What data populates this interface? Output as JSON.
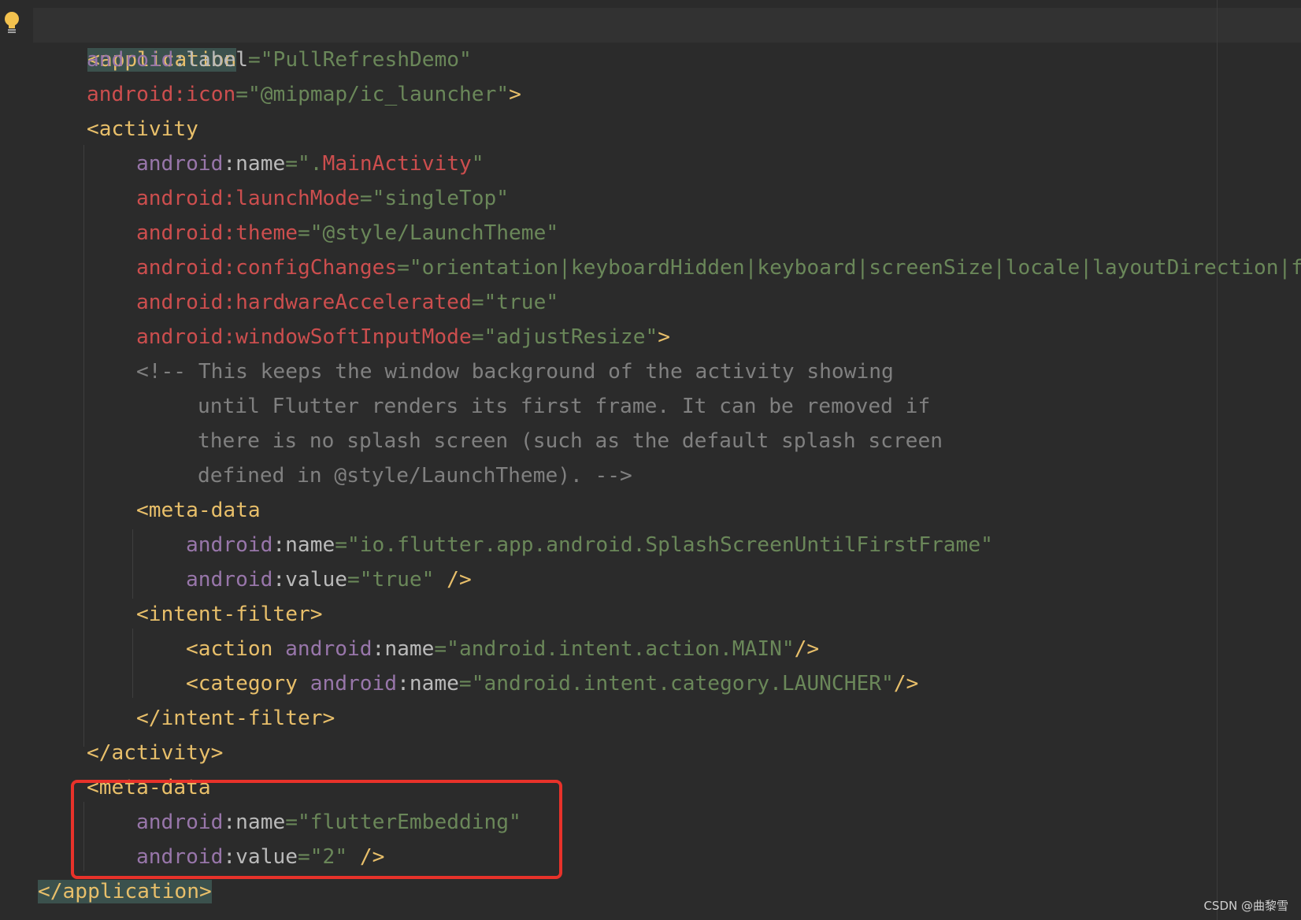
{
  "lines": [
    {
      "tag_open": "<application"
    },
    {
      "ns": "android",
      "attr": "label",
      "value": "PullRefreshDemo"
    },
    {
      "ns": "android",
      "attr": "icon",
      "value": "@mipmap/ic_launcher",
      "close": ">"
    },
    {
      "tag_open": "<activity"
    },
    {
      "ns": "android",
      "attr": "name",
      "value_prefix": ".",
      "value": "MainActivity"
    },
    {
      "ns": "android",
      "attr": "launchMode",
      "value": "singleTop"
    },
    {
      "ns": "android",
      "attr": "theme",
      "value": "@style/LaunchTheme"
    },
    {
      "ns": "android",
      "attr": "configChanges",
      "value": "orientation|keyboardHidden|keyboard|screenSize|locale|layoutDirection|fo"
    },
    {
      "ns": "android",
      "attr": "hardwareAccelerated",
      "value": "true"
    },
    {
      "ns": "android",
      "attr": "windowSoftInputMode",
      "value": "adjustResize",
      "close": ">"
    },
    {
      "comment": "<!-- This keeps the window background of the activity showing"
    },
    {
      "comment": "until Flutter renders its first frame. It can be removed if"
    },
    {
      "comment": "there is no splash screen (such as the default splash screen"
    },
    {
      "comment": "defined in @style/LaunchTheme). -->"
    },
    {
      "tag_open": "<meta-data"
    },
    {
      "ns": "android",
      "attr": "name",
      "value": "io.flutter.app.android.SplashScreenUntilFirstFrame"
    },
    {
      "ns": "android",
      "attr": "value",
      "value": "true",
      "close": " />"
    },
    {
      "tag_open": "<intent-filter>"
    },
    {
      "tag_open": "<action",
      "ns": "android",
      "attr": "name",
      "value": "android.intent.action.MAIN",
      "close": "/>"
    },
    {
      "tag_open": "<category",
      "ns": "android",
      "attr": "name",
      "value": "android.intent.category.LAUNCHER",
      "close": "/>"
    },
    {
      "tag_open": "</intent-filter>"
    },
    {
      "tag_open": "</activity>"
    },
    {
      "tag_open": "<meta-data"
    },
    {
      "ns": "android",
      "attr": "name",
      "value": "flutterEmbedding"
    },
    {
      "ns": "android",
      "attr": "value",
      "value": "2",
      "close": " />"
    },
    {
      "tag_open": "</application>"
    }
  ],
  "watermark": "CSDN @曲黎雪"
}
